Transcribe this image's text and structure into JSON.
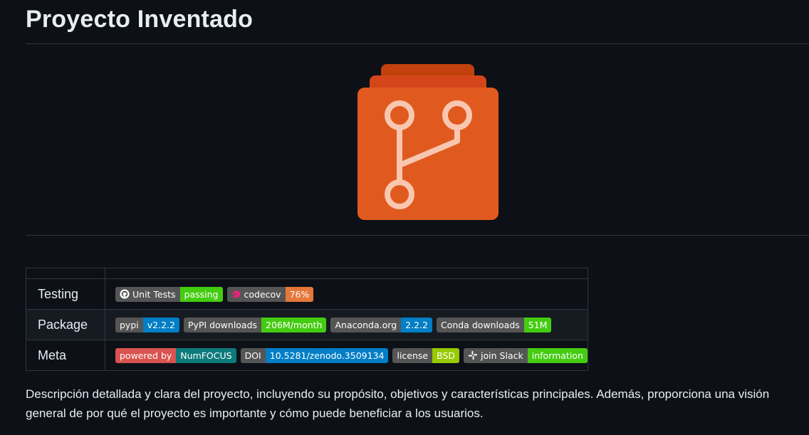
{
  "page": {
    "title": "Proyecto Inventado",
    "description": "Descripción detallada y clara del proyecto, incluyendo su propósito, objetivos y características principales. Además, proporciona una visión general de por qué el proyecto es importante y cómo puede beneficiar a los usuarios."
  },
  "logo": {
    "icon": "git-branch-icon",
    "colors": {
      "body": "#e05a1f",
      "back": "#c2410c",
      "mid": "#d4461a",
      "stroke": "#f9c7b0"
    }
  },
  "badges_table": {
    "rows": [
      {
        "label": "Testing",
        "badges": [
          {
            "left": "Unit Tests",
            "right": "passing",
            "icon": "github-icon",
            "right_color": "#4c1"
          },
          {
            "left": "codecov",
            "right": "76%",
            "icon": "codecov-icon",
            "right_color": "#e5783a"
          }
        ]
      },
      {
        "label": "Package",
        "badges": [
          {
            "left": "pypi",
            "right": "v2.2.2",
            "right_color": "#007ec6"
          },
          {
            "left": "PyPI downloads",
            "right": "206M/month",
            "right_color": "#4c1"
          },
          {
            "left": "Anaconda.org",
            "right": "2.2.2",
            "right_color": "#007ec6"
          },
          {
            "left": "Conda downloads",
            "right": "51M",
            "right_color": "#4c1"
          }
        ]
      },
      {
        "label": "Meta",
        "badges": [
          {
            "left": "powered by",
            "right": "NumFOCUS",
            "left_color": "#d9534f",
            "right_color": "#0e7a7a"
          },
          {
            "left": "DOI",
            "right": "10.5281/zenodo.3509134",
            "right_color": "#007ec6"
          },
          {
            "left": "license",
            "right": "BSD",
            "right_color": "#97ca00"
          },
          {
            "left": "join Slack",
            "right": "information",
            "icon": "slack-icon",
            "right_color": "#4c1"
          }
        ]
      }
    ]
  }
}
